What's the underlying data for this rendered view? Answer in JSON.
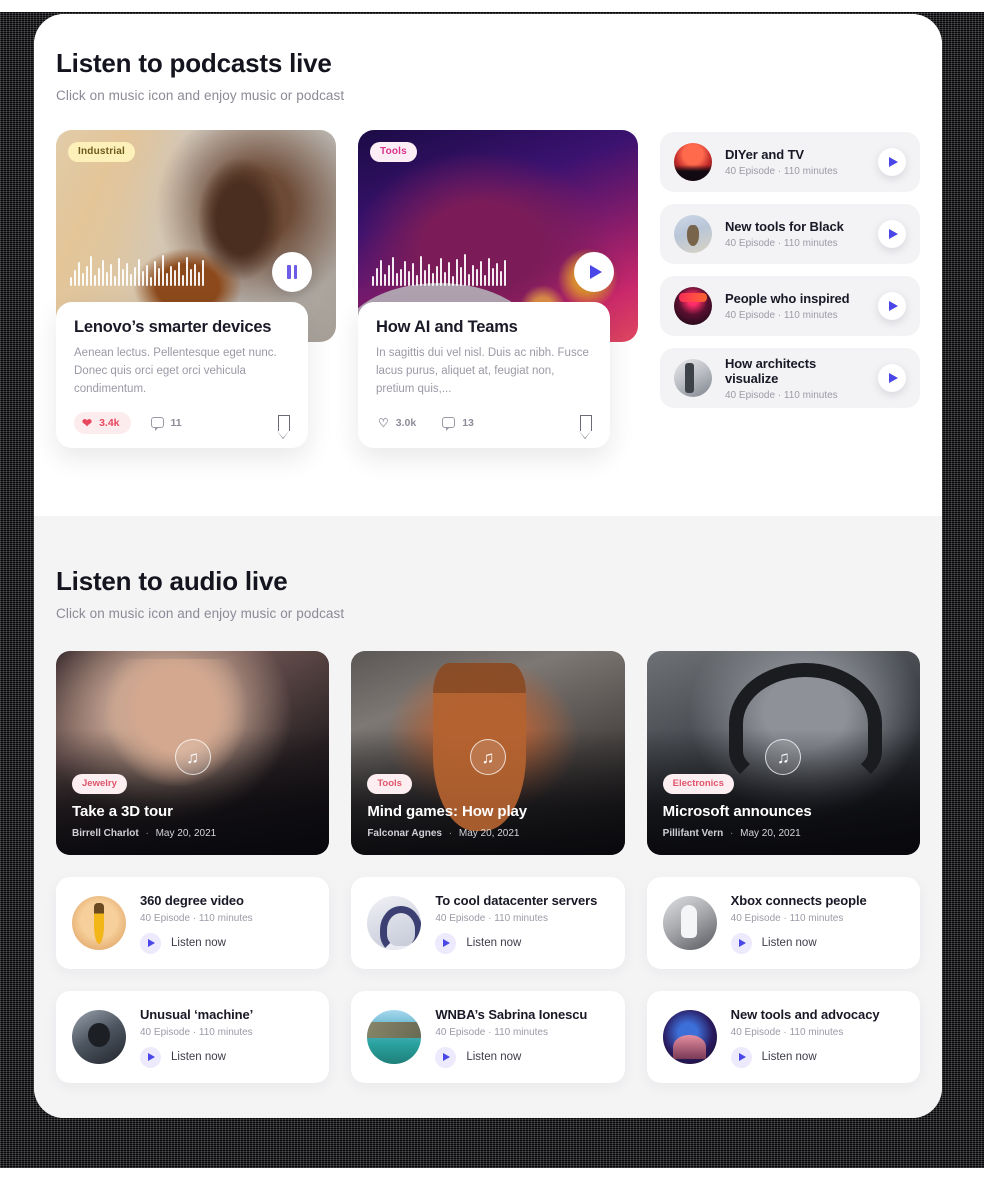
{
  "sections": {
    "podcasts": {
      "title": "Listen to podcasts live",
      "subtitle": "Click on music icon and enjoy music or podcast"
    },
    "audio": {
      "title": "Listen to audio live",
      "subtitle": "Click on music icon and enjoy music or podcast"
    }
  },
  "featured": [
    {
      "tag": "Industrial",
      "title": "Lenovo’s smarter devices",
      "desc": "Aenean lectus. Pellentesque eget nunc. Donec quis orci eget orci vehicula condimentum.",
      "likes": "3.4k",
      "comments": "11",
      "player_icon": "pause-icon",
      "liked": true
    },
    {
      "tag": "Tools",
      "title": "How AI and Teams",
      "desc": "In sagittis dui vel nisl. Duis ac nibh. Fusce lacus purus, aliquet at, feugiat non, pretium quis,...",
      "likes": "3.0k",
      "comments": "13",
      "player_icon": "play-icon",
      "liked": false
    }
  ],
  "podcast_list": [
    {
      "title": "DIYer and TV",
      "meta": "40 Episode · 110 minutes"
    },
    {
      "title": "New tools for Black",
      "meta": "40 Episode · 110 minutes"
    },
    {
      "title": "People who inspired",
      "meta": "40 Episode · 110 minutes"
    },
    {
      "title": "How architects visualize",
      "meta": "40 Episode · 110 minutes"
    }
  ],
  "audio_cards": [
    {
      "tag": "Jewelry",
      "title": "Take a 3D tour",
      "author": "Birrell Charlot",
      "date": "May 20, 2021",
      "icon": "music-note-icon"
    },
    {
      "tag": "Tools",
      "title": "Mind games: How play",
      "author": "Falconar Agnes",
      "date": "May 20, 2021",
      "icon": "music-note-icon"
    },
    {
      "tag": "Electronics",
      "title": "Microsoft announces",
      "author": "Pillifant Vern",
      "date": "May 20, 2021",
      "icon": "music-note-icon"
    }
  ],
  "audio_list": [
    {
      "title": "360 degree video",
      "meta": "40 Episode · 110 minutes",
      "action": "Listen now"
    },
    {
      "title": "To cool datacenter servers",
      "meta": "40 Episode · 110 minutes",
      "action": "Listen now"
    },
    {
      "title": "Xbox connects people",
      "meta": "40 Episode · 110 minutes",
      "action": "Listen now"
    },
    {
      "title": "Unusual ‘machine’",
      "meta": "40 Episode · 110 minutes",
      "action": "Listen now"
    },
    {
      "title": "WNBA’s Sabrina Ionescu",
      "meta": "40 Episode · 110 minutes",
      "action": "Listen now"
    },
    {
      "title": "New tools and advocacy",
      "meta": "40 Episode · 110 minutes",
      "action": "Listen now"
    }
  ],
  "icons": {
    "music_note": "♫",
    "separator": "·"
  },
  "colors": {
    "accent_purple": "#4a46e8",
    "like_red": "#e8485e",
    "tag_yellow_bg": "#fdf0b8",
    "tag_pink_bg": "#fdeef6",
    "page_bg": "#ffffff",
    "audio_bg": "#f4f4f5"
  }
}
